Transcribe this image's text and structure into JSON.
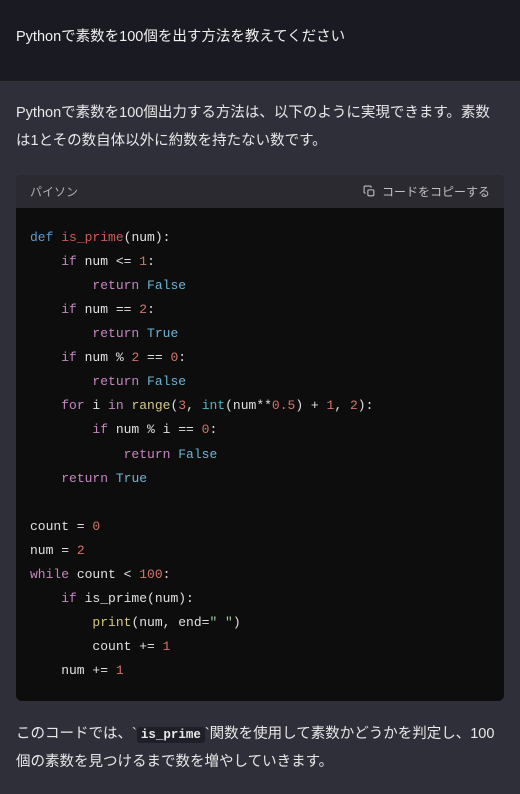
{
  "user_message": "Pythonで素数を100個を出す方法を教えてください",
  "intro": "Pythonで素数を100個出力する方法は、以下のように実現できます。素数は1とその数自体以外に約数を持たない数です。",
  "code_block": {
    "language": "パイソン",
    "copy_label": "コードをコピーする",
    "tokens": [
      {
        "t": "kw",
        "v": "def"
      },
      {
        "t": "sp",
        "v": " "
      },
      {
        "t": "fnname",
        "v": "is_prime"
      },
      {
        "t": "p",
        "v": "(num):"
      },
      {
        "t": "nl"
      },
      {
        "t": "sp",
        "v": "    "
      },
      {
        "t": "kw2",
        "v": "if"
      },
      {
        "t": "p",
        "v": " num <= "
      },
      {
        "t": "num",
        "v": "1"
      },
      {
        "t": "p",
        "v": ":"
      },
      {
        "t": "nl"
      },
      {
        "t": "sp",
        "v": "        "
      },
      {
        "t": "kw2",
        "v": "return"
      },
      {
        "t": "sp",
        "v": " "
      },
      {
        "t": "bool",
        "v": "False"
      },
      {
        "t": "nl"
      },
      {
        "t": "sp",
        "v": "    "
      },
      {
        "t": "kw2",
        "v": "if"
      },
      {
        "t": "p",
        "v": " num == "
      },
      {
        "t": "num",
        "v": "2"
      },
      {
        "t": "p",
        "v": ":"
      },
      {
        "t": "nl"
      },
      {
        "t": "sp",
        "v": "        "
      },
      {
        "t": "kw2",
        "v": "return"
      },
      {
        "t": "sp",
        "v": " "
      },
      {
        "t": "bool",
        "v": "True"
      },
      {
        "t": "nl"
      },
      {
        "t": "sp",
        "v": "    "
      },
      {
        "t": "kw2",
        "v": "if"
      },
      {
        "t": "p",
        "v": " num % "
      },
      {
        "t": "num",
        "v": "2"
      },
      {
        "t": "p",
        "v": " == "
      },
      {
        "t": "num",
        "v": "0"
      },
      {
        "t": "p",
        "v": ":"
      },
      {
        "t": "nl"
      },
      {
        "t": "sp",
        "v": "        "
      },
      {
        "t": "kw2",
        "v": "return"
      },
      {
        "t": "sp",
        "v": " "
      },
      {
        "t": "bool",
        "v": "False"
      },
      {
        "t": "nl"
      },
      {
        "t": "sp",
        "v": "    "
      },
      {
        "t": "kw2",
        "v": "for"
      },
      {
        "t": "p",
        "v": " i "
      },
      {
        "t": "kw2",
        "v": "in"
      },
      {
        "t": "sp",
        "v": " "
      },
      {
        "t": "fn",
        "v": "range"
      },
      {
        "t": "p",
        "v": "("
      },
      {
        "t": "num",
        "v": "3"
      },
      {
        "t": "p",
        "v": ", "
      },
      {
        "t": "builtin",
        "v": "int"
      },
      {
        "t": "p",
        "v": "(num**"
      },
      {
        "t": "num",
        "v": "0.5"
      },
      {
        "t": "p",
        "v": ") + "
      },
      {
        "t": "num",
        "v": "1"
      },
      {
        "t": "p",
        "v": ", "
      },
      {
        "t": "num",
        "v": "2"
      },
      {
        "t": "p",
        "v": "):"
      },
      {
        "t": "nl"
      },
      {
        "t": "sp",
        "v": "        "
      },
      {
        "t": "kw2",
        "v": "if"
      },
      {
        "t": "p",
        "v": " num % i == "
      },
      {
        "t": "num",
        "v": "0"
      },
      {
        "t": "p",
        "v": ":"
      },
      {
        "t": "nl"
      },
      {
        "t": "sp",
        "v": "            "
      },
      {
        "t": "kw2",
        "v": "return"
      },
      {
        "t": "sp",
        "v": " "
      },
      {
        "t": "bool",
        "v": "False"
      },
      {
        "t": "nl"
      },
      {
        "t": "sp",
        "v": "    "
      },
      {
        "t": "kw2",
        "v": "return"
      },
      {
        "t": "sp",
        "v": " "
      },
      {
        "t": "bool",
        "v": "True"
      },
      {
        "t": "nl"
      },
      {
        "t": "nl"
      },
      {
        "t": "p",
        "v": "count = "
      },
      {
        "t": "num",
        "v": "0"
      },
      {
        "t": "nl"
      },
      {
        "t": "p",
        "v": "num = "
      },
      {
        "t": "num",
        "v": "2"
      },
      {
        "t": "nl"
      },
      {
        "t": "kw2",
        "v": "while"
      },
      {
        "t": "p",
        "v": " count < "
      },
      {
        "t": "num",
        "v": "100"
      },
      {
        "t": "p",
        "v": ":"
      },
      {
        "t": "nl"
      },
      {
        "t": "sp",
        "v": "    "
      },
      {
        "t": "kw2",
        "v": "if"
      },
      {
        "t": "p",
        "v": " is_prime(num):"
      },
      {
        "t": "nl"
      },
      {
        "t": "sp",
        "v": "        "
      },
      {
        "t": "fn",
        "v": "print"
      },
      {
        "t": "p",
        "v": "(num, end="
      },
      {
        "t": "str",
        "v": "\" \""
      },
      {
        "t": "p",
        "v": ")"
      },
      {
        "t": "nl"
      },
      {
        "t": "sp",
        "v": "        count += "
      },
      {
        "t": "num",
        "v": "1"
      },
      {
        "t": "nl"
      },
      {
        "t": "sp",
        "v": "    num += "
      },
      {
        "t": "num",
        "v": "1"
      }
    ]
  },
  "outro": {
    "before_code": "このコードでは、`",
    "inline_code": "is_prime",
    "after_code": "`関数を使用して素数かどうかを判定し、100個の素数を見つけるまで数を増やしていきます。"
  }
}
